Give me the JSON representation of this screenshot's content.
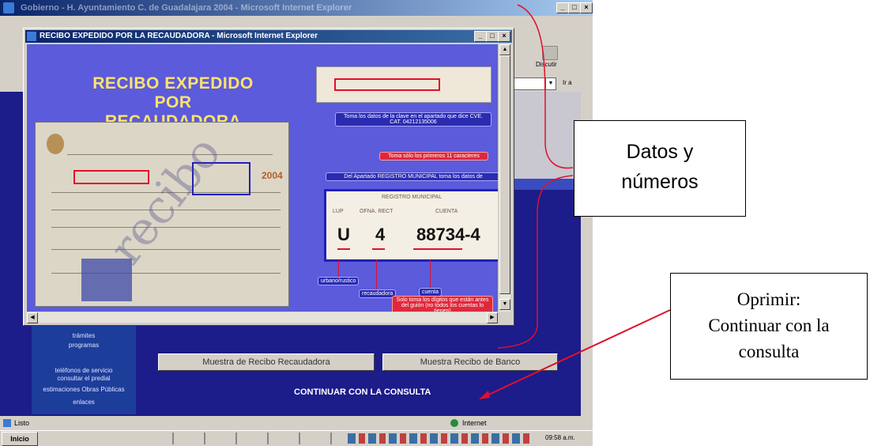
{
  "outer_window": {
    "title": "Gobierno - H. Ayuntamiento C. de Guadalajara 2004 - Microsoft Internet Explorer",
    "toolbar_label": "Discutir",
    "go_label": "Ir a",
    "status_left": "Listo",
    "status_right": "Internet",
    "left_menu": [
      "trámites",
      "programas",
      "teléfonos de servicio",
      "consultar el predial",
      "estimaciones Obras Públicas",
      "enlaces"
    ],
    "buttons": {
      "receipt_sample": "Muestra de Recibo Recaudadora",
      "bank_sample": "Muestra Recibo de Banco",
      "continue": "CONTINUAR CON LA CONSULTA"
    },
    "taskbar": {
      "start": "Inicio",
      "clock": "09:58 a.m."
    }
  },
  "popup": {
    "title": "RECIBO EXPEDIDO POR LA RECAUDADORA - Microsoft Internet Explorer",
    "heading_line1": "RECIBO EXPEDIDO POR",
    "heading_line2": "RECAUDADORA",
    "instructions": {
      "take_data": "Toma los datos de la clave en el apartado que dice CVE. CAT. 04212135006",
      "first_chars": "Toma sólo los primeros 11 caracteres",
      "from_section": "Del Apartado REGISTRO MUNICIPAL toma los datos de",
      "only_digits": "Solo toma los dígitos que están antes del guión (no todos los cuentas lo tienen)"
    },
    "registro": {
      "title": "REGISTRO MUNICIPAL",
      "col1": "LUP",
      "col2": "OFNA. RECT",
      "col3": "CUENTA",
      "val1": "U",
      "val2": "4",
      "val3": "88734-4"
    },
    "labels": {
      "urbano": "urbano/rustico",
      "recaudadora": "recaudadora",
      "cuenta": "cuenta"
    },
    "receipt_year": "2004"
  },
  "callouts": {
    "datos": "Datos y números",
    "oprimir_line1": "Oprimir:",
    "oprimir_line2": "Continuar con la",
    "oprimir_line3": "consulta"
  },
  "colors": {
    "accent_red": "#e0102a",
    "popup_bg": "#5b5bdc",
    "page_blue": "#1c1c8a",
    "heading_yellow": "#ffe36a"
  }
}
